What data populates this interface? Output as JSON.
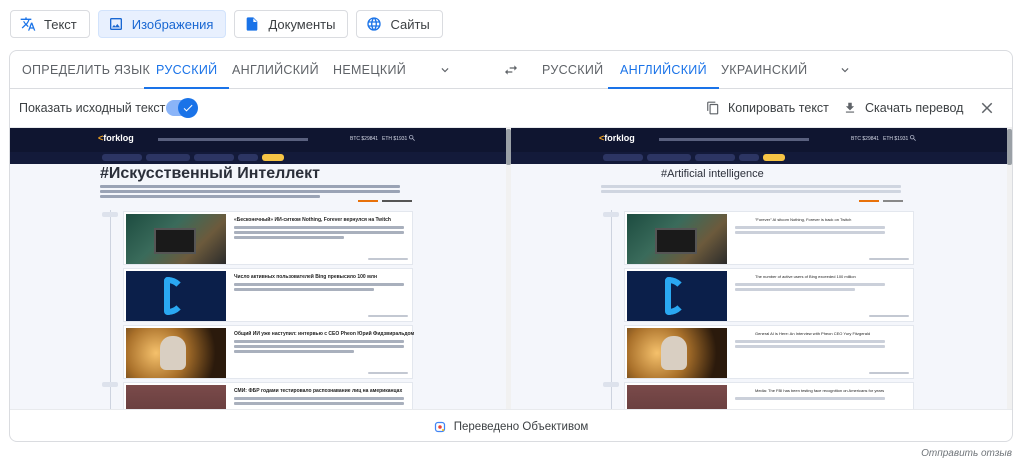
{
  "modes": [
    {
      "label": "Текст",
      "icon": "translate-icon",
      "active": false
    },
    {
      "label": "Изображения",
      "icon": "image-icon",
      "active": true
    },
    {
      "label": "Документы",
      "icon": "document-icon",
      "active": false
    },
    {
      "label": "Сайты",
      "icon": "globe-icon",
      "active": false
    }
  ],
  "source_langs": {
    "detect": "ОПРЕДЕЛИТЬ ЯЗЫК",
    "l1": "РУССКИЙ",
    "l2": "АНГЛИЙСКИЙ",
    "l3": "НЕМЕЦКИЙ",
    "selected": "РУССКИЙ"
  },
  "target_langs": {
    "l1": "РУССКИЙ",
    "l2": "АНГЛИЙСКИЙ",
    "l3": "УКРАИНСКИЙ",
    "selected": "АНГЛИЙСКИЙ"
  },
  "toolbar": {
    "show_original_label": "Показать исходный текст",
    "show_original_on": true,
    "copy_label": "Копировать текст",
    "download_label": "Скачать перевод"
  },
  "left_image": {
    "logo": "forklog",
    "title": "#Искусственный Интеллект",
    "prices": [
      "BTC $29841",
      "ETH $1931"
    ],
    "articles": [
      {
        "title": "«Бесконечный» ИИ-ситком Nothing, Forever вернулся на Twitch"
      },
      {
        "title": "Число активных пользователей Bing превысило 100 млн"
      },
      {
        "title": "Общий ИИ уже наступил: интервью с CEO Pheon Юрий Фидзвиральдом"
      },
      {
        "title": "СМИ: ФБР годами тестировало распознавание лиц на американцах"
      }
    ]
  },
  "right_image": {
    "logo": "forklog",
    "title": "#Artificial intelligence",
    "prices": [
      "BTC $29841",
      "ETH $1931"
    ],
    "articles": [
      {
        "title": "\"Forever\" AI sitcom Nothing, Forever is back on Twitch"
      },
      {
        "title": "The number of active users of Bing exceeded 100 million"
      },
      {
        "title": "General AI is Here: An Interview with Pheon CEO Yury Fitzgerald"
      },
      {
        "title": "Media: The FBI has been testing face recognition on Americans for years"
      }
    ]
  },
  "footer": {
    "label": "Переведено Объективом"
  },
  "feedback": "Отправить отзыв",
  "colors": {
    "accent": "#1a73e8",
    "active_bg": "#e8f0fe",
    "site_header": "#0f1530",
    "site_accent": "#f6a623"
  }
}
